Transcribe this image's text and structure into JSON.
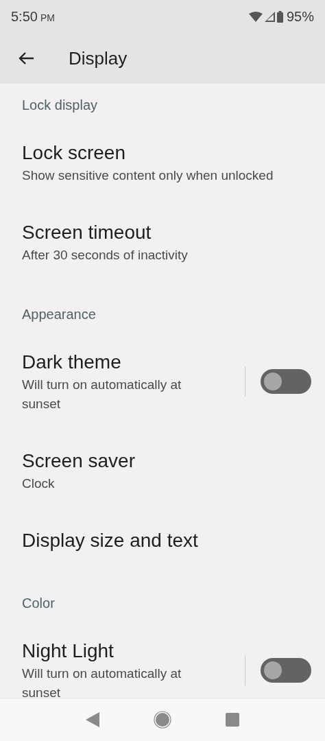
{
  "status_bar": {
    "time": "5:50",
    "am_pm": "PM",
    "battery": "95%"
  },
  "app_bar": {
    "title": "Display"
  },
  "sections": [
    {
      "header": "Lock display",
      "items": [
        {
          "kind": "text",
          "title": "Lock screen",
          "subtitle": "Show sensitive content only when unlocked"
        },
        {
          "kind": "text",
          "title": "Screen timeout",
          "subtitle": "After 30 seconds of inactivity"
        }
      ]
    },
    {
      "header": "Appearance",
      "items": [
        {
          "kind": "switch",
          "title": "Dark theme",
          "subtitle": "Will turn on automatically at sunset",
          "on": false
        },
        {
          "kind": "text",
          "title": "Screen saver",
          "subtitle": "Clock"
        },
        {
          "kind": "text",
          "title": "Display size and text"
        }
      ]
    },
    {
      "header": "Color",
      "items": [
        {
          "kind": "switch",
          "title": "Night Light",
          "subtitle": "Will turn on automatically at sunset",
          "on": false
        }
      ]
    }
  ]
}
